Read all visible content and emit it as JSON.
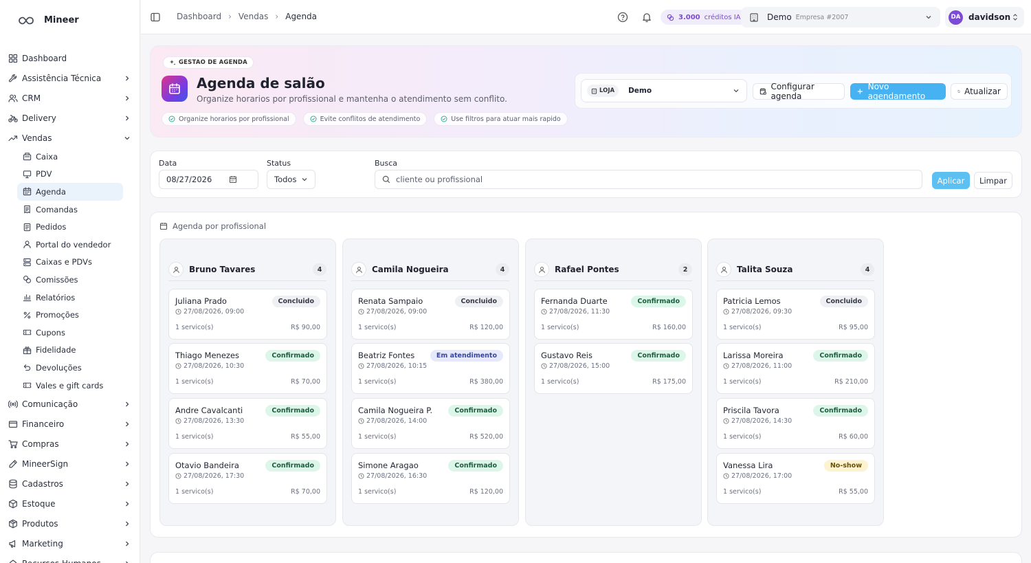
{
  "brand": {
    "name": "Mineer"
  },
  "sidebar": {
    "items": [
      {
        "label": "Dashboard",
        "icon": "dashboard-icon",
        "chevron": ""
      },
      {
        "label": "Assistência Técnica",
        "icon": "wrench-icon",
        "chevron": "right"
      },
      {
        "label": "CRM",
        "icon": "users-icon",
        "chevron": "right"
      },
      {
        "label": "Delivery",
        "icon": "bike-icon",
        "chevron": "right"
      },
      {
        "label": "Vendas",
        "icon": "trending-up-icon",
        "chevron": "down"
      }
    ],
    "vendas_sub": [
      {
        "label": "Caixa",
        "icon": "cash-register-icon",
        "active": false
      },
      {
        "label": "PDV",
        "icon": "monitor-icon",
        "active": false
      },
      {
        "label": "Agenda",
        "icon": "calendar-icon",
        "active": true
      },
      {
        "label": "Comandas",
        "icon": "receipt-icon",
        "active": false
      },
      {
        "label": "Pedidos",
        "icon": "file-list-icon",
        "active": false
      },
      {
        "label": "Portal do vendedor",
        "icon": "user-icon",
        "active": false
      },
      {
        "label": "Caixas e PDVs",
        "icon": "server-icon",
        "active": false
      },
      {
        "label": "Comissões",
        "icon": "coins-icon",
        "active": false
      },
      {
        "label": "Relatórios",
        "icon": "bar-chart-icon",
        "active": false
      },
      {
        "label": "Promoções",
        "icon": "percent-icon",
        "active": false
      },
      {
        "label": "Cupons",
        "icon": "ticket-icon",
        "active": false
      },
      {
        "label": "Fidelidade",
        "icon": "gift-icon",
        "active": false
      },
      {
        "label": "Devoluções",
        "icon": "undo-icon",
        "active": false
      },
      {
        "label": "Vales e gift cards",
        "icon": "ticket-icon",
        "active": false
      }
    ],
    "after_items": [
      {
        "label": "Comunicação",
        "icon": "broadcast-icon"
      },
      {
        "label": "Financeiro",
        "icon": "wallet-icon"
      },
      {
        "label": "Compras",
        "icon": "cart-icon"
      },
      {
        "label": "MineerSign",
        "icon": "pen-icon"
      },
      {
        "label": "Cadastros",
        "icon": "database-icon"
      },
      {
        "label": "Estoque",
        "icon": "package-icon"
      },
      {
        "label": "Produtos",
        "icon": "box-icon"
      },
      {
        "label": "Marketing",
        "icon": "megaphone-icon"
      },
      {
        "label": "Recursos Humanos",
        "icon": "building-icon"
      }
    ]
  },
  "topbar": {
    "breadcrumbs": [
      "Dashboard",
      "Vendas",
      "Agenda"
    ],
    "credits": {
      "amount": "3.000",
      "label": "créditos IA"
    },
    "company": {
      "name": "Demo",
      "sub": "Empresa #2007"
    },
    "user": {
      "initials": "DA",
      "name": "davidson"
    }
  },
  "hero": {
    "tag": "GESTAO DE AGENDA",
    "title": "Agenda de salão",
    "subtitle": "Organize horarios por profissional e mantenha o atendimento sem conflito.",
    "chips": [
      "Organize horarios por profissional",
      "Evite conflitos de atendimento",
      "Use filtros para atuar mais rapido"
    ],
    "loja_label": "LOJA",
    "loja_value": "Demo",
    "btn_config": "Configurar agenda",
    "btn_new": "Novo agendamento",
    "btn_refresh": "Atualizar"
  },
  "filters": {
    "date_label": "Data",
    "date_value": "08/27/2026",
    "status_label": "Status",
    "status_value": "Todos",
    "search_label": "Busca",
    "search_placeholder": "cliente ou profissional",
    "apply": "Aplicar",
    "clear": "Limpar"
  },
  "board": {
    "title": "Agenda por profissional",
    "columns": [
      {
        "name": "Bruno Tavares",
        "count": "4",
        "cards": [
          {
            "client": "Juliana Prado",
            "time": "27/08/2026, 09:00",
            "services": "1 servico(s)",
            "price": "R$ 90,00",
            "status": "Concluido",
            "status_kind": "concluido"
          },
          {
            "client": "Thiago Menezes",
            "time": "27/08/2026, 10:30",
            "services": "1 servico(s)",
            "price": "R$ 70,00",
            "status": "Confirmado",
            "status_kind": "confirmado"
          },
          {
            "client": "Andre Cavalcanti",
            "time": "27/08/2026, 13:30",
            "services": "1 servico(s)",
            "price": "R$ 55,00",
            "status": "Confirmado",
            "status_kind": "confirmado"
          },
          {
            "client": "Otavio Bandeira",
            "time": "27/08/2026, 17:30",
            "services": "1 servico(s)",
            "price": "R$ 70,00",
            "status": "Confirmado",
            "status_kind": "confirmado"
          }
        ]
      },
      {
        "name": "Camila Nogueira",
        "count": "4",
        "cards": [
          {
            "client": "Renata Sampaio",
            "time": "27/08/2026, 09:00",
            "services": "1 servico(s)",
            "price": "R$ 120,00",
            "status": "Concluido",
            "status_kind": "concluido"
          },
          {
            "client": "Beatriz Fontes",
            "time": "27/08/2026, 10:15",
            "services": "1 servico(s)",
            "price": "R$ 380,00",
            "status": "Em atendimento",
            "status_kind": "atendimento"
          },
          {
            "client": "Camila Nogueira P.",
            "time": "27/08/2026, 14:00",
            "services": "1 servico(s)",
            "price": "R$ 520,00",
            "status": "Confirmado",
            "status_kind": "confirmado"
          },
          {
            "client": "Simone Aragao",
            "time": "27/08/2026, 16:30",
            "services": "1 servico(s)",
            "price": "R$ 120,00",
            "status": "Confirmado",
            "status_kind": "confirmado"
          }
        ]
      },
      {
        "name": "Rafael Pontes",
        "count": "2",
        "cards": [
          {
            "client": "Fernanda Duarte",
            "time": "27/08/2026, 11:30",
            "services": "1 servico(s)",
            "price": "R$ 160,00",
            "status": "Confirmado",
            "status_kind": "confirmado"
          },
          {
            "client": "Gustavo Reis",
            "time": "27/08/2026, 15:00",
            "services": "1 servico(s)",
            "price": "R$ 175,00",
            "status": "Confirmado",
            "status_kind": "confirmado"
          }
        ]
      },
      {
        "name": "Talita Souza",
        "count": "4",
        "cards": [
          {
            "client": "Patricia Lemos",
            "time": "27/08/2026, 09:30",
            "services": "1 servico(s)",
            "price": "R$ 95,00",
            "status": "Concluido",
            "status_kind": "concluido"
          },
          {
            "client": "Larissa Moreira",
            "time": "27/08/2026, 11:00",
            "services": "1 servico(s)",
            "price": "R$ 210,00",
            "status": "Confirmado",
            "status_kind": "confirmado"
          },
          {
            "client": "Priscila Tavora",
            "time": "27/08/2026, 14:30",
            "services": "1 servico(s)",
            "price": "R$ 60,00",
            "status": "Confirmado",
            "status_kind": "confirmado"
          },
          {
            "client": "Vanessa Lira",
            "time": "27/08/2026, 17:00",
            "services": "1 servico(s)",
            "price": "R$ 55,00",
            "status": "No-show",
            "status_kind": "noshow"
          }
        ]
      }
    ]
  },
  "colors": {
    "accent": "#46b2f2",
    "brand_purple": "#7c4ad6",
    "confirmed": "#dcf6ea",
    "noshow": "#fdf3cf"
  }
}
